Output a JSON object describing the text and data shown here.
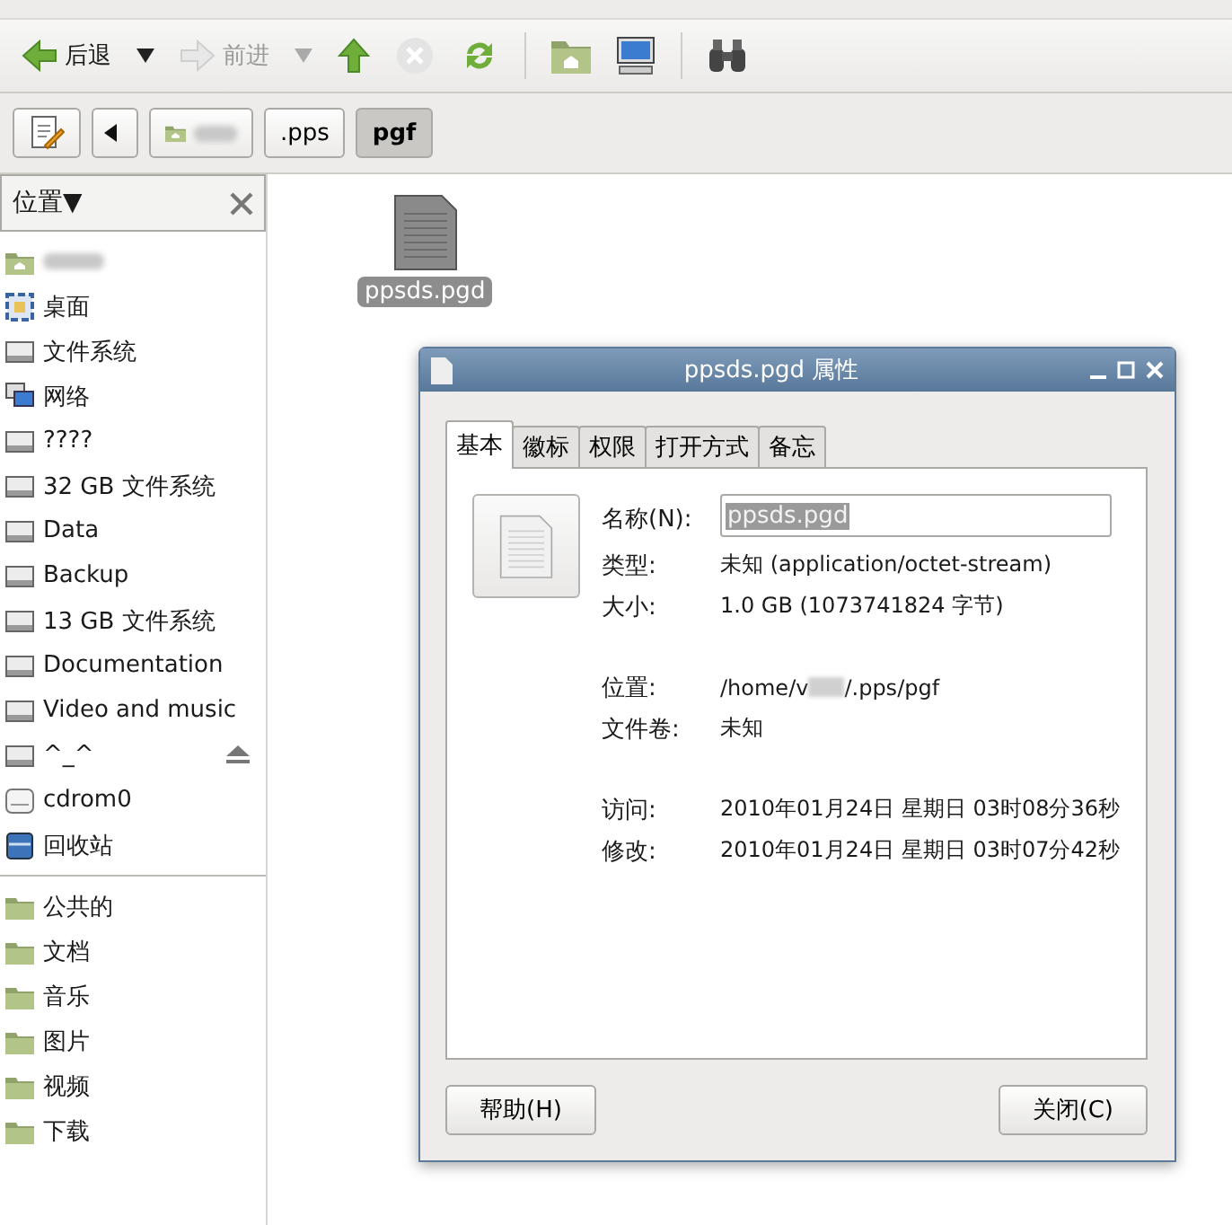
{
  "toolbar": [
    {
      "kind": "back",
      "label": "后退",
      "disabled": false
    },
    {
      "kind": "back-menu",
      "disabled": false
    },
    {
      "kind": "forward",
      "label": "前进",
      "disabled": true
    },
    {
      "kind": "forward-menu",
      "disabled": true
    },
    {
      "kind": "up",
      "disabled": false
    },
    {
      "kind": "stop",
      "disabled": true
    },
    {
      "kind": "reload",
      "disabled": false
    },
    {
      "kind": "sep"
    },
    {
      "kind": "home"
    },
    {
      "kind": "computer"
    },
    {
      "kind": "sep"
    },
    {
      "kind": "search"
    }
  ],
  "path_bar": {
    "crumbs": [
      {
        "kind": "home",
        "selected": false
      },
      {
        "kind": "dir",
        "label": ".pps",
        "selected": false
      },
      {
        "kind": "dir",
        "label": "pgf",
        "selected": true
      }
    ]
  },
  "sidebar": {
    "title": "位置▼",
    "places": [
      {
        "kind": "home",
        "eject": false
      },
      {
        "kind": "desktop",
        "label": "桌面",
        "eject": false
      },
      {
        "kind": "drive",
        "label": "文件系统",
        "eject": false
      },
      {
        "kind": "network",
        "label": "网络",
        "eject": false
      },
      {
        "kind": "drive",
        "label": "????",
        "eject": false
      },
      {
        "kind": "drive",
        "label": "32 GB 文件系统",
        "eject": false
      },
      {
        "kind": "drive",
        "label": "Data",
        "eject": false
      },
      {
        "kind": "drive",
        "label": "Backup",
        "eject": false
      },
      {
        "kind": "drive",
        "label": "13 GB 文件系统",
        "eject": false
      },
      {
        "kind": "drive",
        "label": "Documentation",
        "eject": false
      },
      {
        "kind": "drive",
        "label": "Video and music",
        "eject": false
      },
      {
        "kind": "drive",
        "label": "^_^",
        "eject": true
      },
      {
        "kind": "cdrom",
        "label": "cdrom0",
        "eject": false
      },
      {
        "kind": "trash",
        "label": "回收站",
        "eject": false
      }
    ],
    "bookmarks": [
      {
        "kind": "folder",
        "label": "公共的"
      },
      {
        "kind": "folder",
        "label": "文档"
      },
      {
        "kind": "folder",
        "label": "音乐"
      },
      {
        "kind": "folder",
        "label": "图片"
      },
      {
        "kind": "folder",
        "label": "视频"
      },
      {
        "kind": "folder",
        "label": "下载"
      }
    ]
  },
  "files": [
    {
      "name": "ppsds.pgd",
      "selected": true
    }
  ],
  "dialog": {
    "title": "ppsds.pgd 属性",
    "tabs": [
      {
        "label": "基本",
        "selected": true
      },
      {
        "label": "徽标",
        "selected": false
      },
      {
        "label": "权限",
        "selected": false
      },
      {
        "label": "打开方式",
        "selected": false
      },
      {
        "label": "备忘",
        "selected": false
      }
    ],
    "name_label": "名称(N):",
    "name_value": "ppsds.pgd",
    "groups": [
      [
        {
          "label": "类型:",
          "value": "未知 (application/octet-stream)"
        },
        {
          "label": "大小:",
          "value": "1.0 GB (1073741824 字节)"
        }
      ],
      [
        {
          "label": "位置:",
          "value": "/home/v",
          "value_after_redaction": "/.pps/pgf"
        },
        {
          "label": "文件卷:",
          "value": "未知"
        }
      ],
      [
        {
          "label": "访问:",
          "value": "2010年01月24日 星期日 03时08分36秒"
        },
        {
          "label": "修改:",
          "value": "2010年01月24日 星期日 03时07分42秒"
        }
      ]
    ],
    "help_button": "帮助(H)",
    "close_button": "关闭(C)"
  }
}
